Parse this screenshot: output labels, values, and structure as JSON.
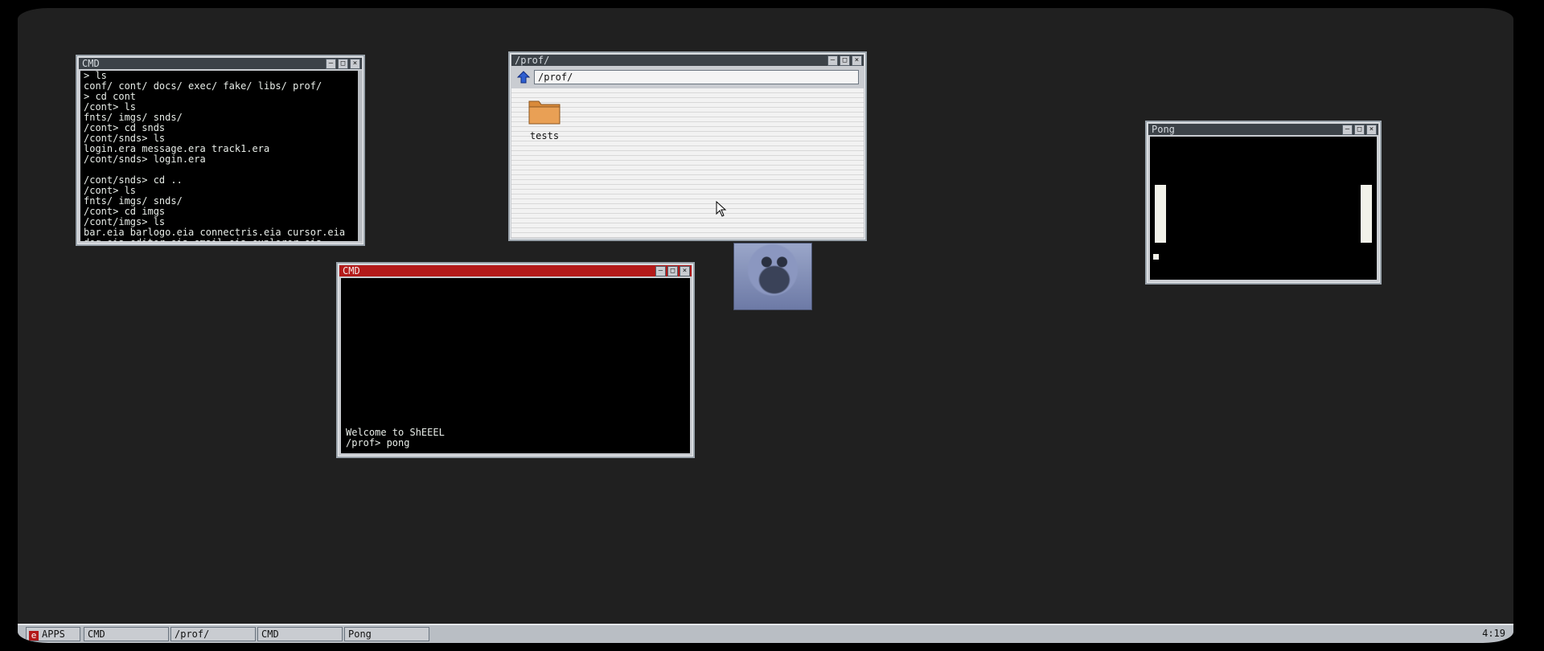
{
  "terminal_left": {
    "title": "CMD",
    "content": "> ls\nconf/ cont/ docs/ exec/ fake/ libs/ prof/\n> cd cont\n/cont> ls\nfnts/ imgs/ snds/\n/cont> cd snds\n/cont/snds> ls\nlogin.era message.era track1.era\n/cont/snds> login.era\n\n/cont/snds> cd ..\n/cont> ls\nfnts/ imgs/ snds/\n/cont> cd imgs\n/cont/imgs> ls\nbar.eia barlogo.eia connectris.eia cursor.eia\ndog.eia editor.eia email.eia explorer.eia\nnotif.eia pong.eia scroll.eia wall.eia web.eia\nwindow.eia wood.eia\n/cont/imgs>"
  },
  "explorer": {
    "title": "/prof/",
    "address": "/prof/",
    "folders": [
      {
        "label": "tests"
      }
    ]
  },
  "terminal_active": {
    "title": "CMD",
    "content": "Welcome to ShEEEL\n/prof> pong"
  },
  "pong": {
    "title": "Pong"
  },
  "taskbar": {
    "apps_label": "APPS",
    "tasks": [
      "CMD",
      "/prof/",
      "CMD",
      "Pong"
    ],
    "clock": "4:19"
  },
  "window_buttons": {
    "minimize": "–",
    "maximize": "□",
    "close": "×"
  },
  "colors": {
    "desktop": "#202020",
    "active_titlebar": "#b31a1a",
    "inactive_titlebar": "#3c4248",
    "folder": "#d98a3a"
  }
}
